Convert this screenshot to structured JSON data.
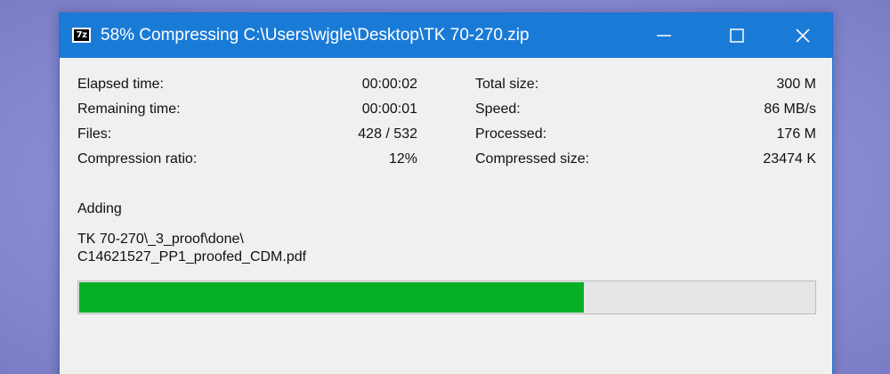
{
  "window": {
    "title": "58% Compressing C:\\Users\\wjgle\\Desktop\\TK 70-270.zip",
    "app_icon_text": "7z",
    "title_color": "#1a7bd7"
  },
  "stats_left": [
    {
      "label": "Elapsed time:",
      "value": "00:00:02"
    },
    {
      "label": "Remaining time:",
      "value": "00:00:01"
    },
    {
      "label": "Files:",
      "value": "428 / 532"
    },
    {
      "label": "Compression ratio:",
      "value": "12%"
    }
  ],
  "stats_right": [
    {
      "label": "Total size:",
      "value": "300 M"
    },
    {
      "label": "Speed:",
      "value": "86 MB/s"
    },
    {
      "label": "Processed:",
      "value": "176 M"
    },
    {
      "label": "Compressed size:",
      "value": "23474 K"
    }
  ],
  "current": {
    "action": "Adding",
    "path_line1": "TK 70-270\\_3_proof\\done\\",
    "path_line2": "C14621527_PP1_proofed_CDM.pdf"
  },
  "progress": {
    "fraction": 0.686,
    "fill_color": "#06b025"
  },
  "icons": [
    "minimize-icon",
    "maximize-icon",
    "close-icon"
  ]
}
